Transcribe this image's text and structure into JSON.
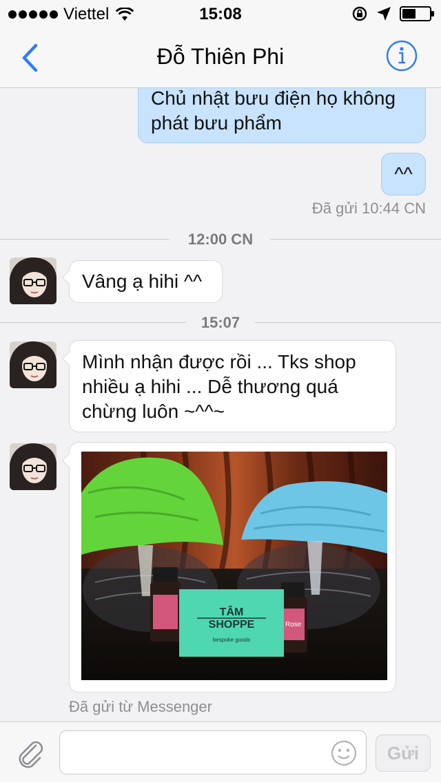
{
  "status_bar": {
    "carrier": "Viettel",
    "time": "15:08",
    "battery_level": 0.5
  },
  "nav": {
    "title": "Đỗ Thiên Phi",
    "back_icon": "chevron-left-icon",
    "info_icon": "info-icon"
  },
  "messages": {
    "out_1": {
      "line1": "Chủ nhật bưu điện họ không",
      "line2": "phát bưu phẩm"
    },
    "out_2": {
      "text": "^^"
    },
    "sent_status": "Đã gửi 10:44 CN",
    "divider_1": "12:00 CN",
    "in_1": {
      "text": "Vâng ạ hihi ^^"
    },
    "divider_2": "15:07",
    "in_2": {
      "line1": "Mình nhận được rồi ... Tks shop",
      "line2": "nhiều ạ hihi ... Dễ thương quá",
      "line3": "chừng luôn ~^^~"
    },
    "photo": {
      "card_line1": "TÂM",
      "card_line2": "SHOPPE",
      "card_tagline": "bespoke goods",
      "bottle_label": "Rose"
    },
    "sent_via": "Đã gửi từ Messenger"
  },
  "input_bar": {
    "placeholder": "",
    "send_label": "Gửi",
    "attach_icon": "paperclip-icon",
    "emoji_icon": "smiley-icon"
  },
  "colors": {
    "accent": "#2f7cf6",
    "outgoing_bubble": "#c7e3fd",
    "incoming_bubble": "#ffffff",
    "background": "#f2f2f4"
  }
}
